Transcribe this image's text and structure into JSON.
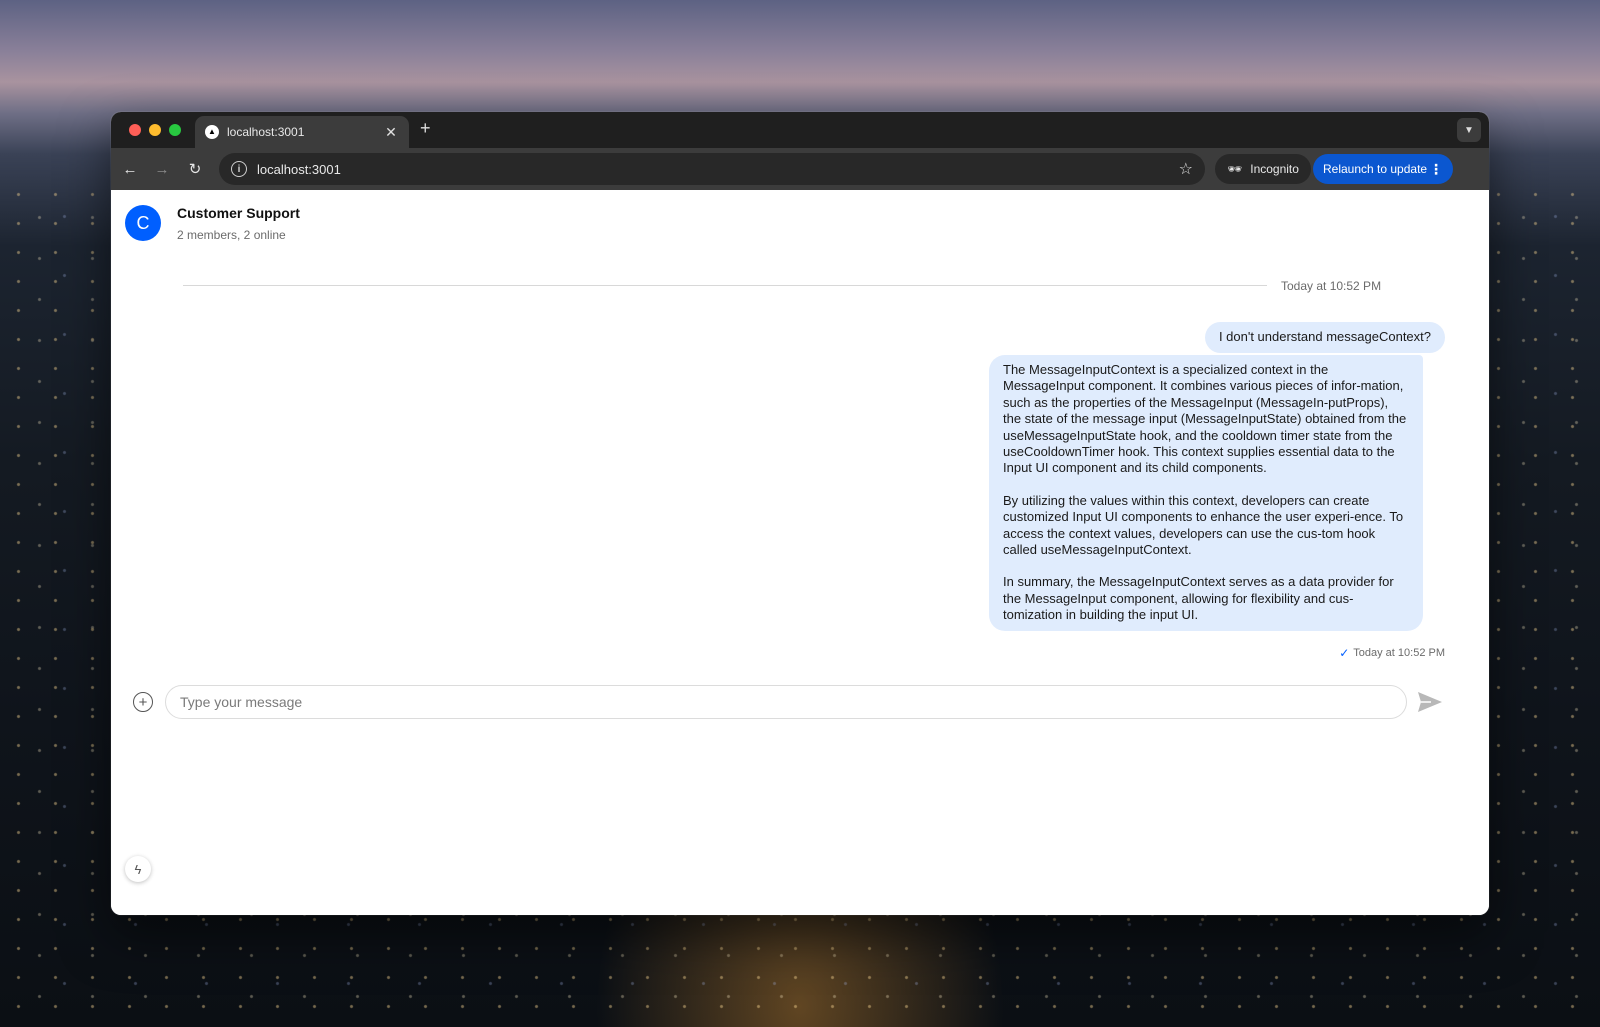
{
  "browser": {
    "tab_title": "localhost:3001",
    "url": "localhost:3001",
    "incognito_label": "Incognito",
    "relaunch_label": "Relaunch to update"
  },
  "channel": {
    "avatar_letter": "C",
    "title": "Customer Support",
    "subtitle": "2 members, 2 online"
  },
  "messages": {
    "date_separator": "Today at 10:52 PM",
    "user_message": "I don't understand messageContext?",
    "reply_paragraphs": [
      "The MessageInputContext is a specialized context in the MessageInput component. It combines various pieces of infor-mation, such as the properties of the MessageInput (MessageIn-putProps), the state of the message input (MessageInputState) obtained from the useMessageInputState hook, and the cooldown timer state from the useCooldownTimer hook. This context supplies essential data to the Input UI component and its child components.",
      "By utilizing the values within this context, developers can create customized Input UI components to enhance the user experi-ence. To access the context values, developers can use the cus-tom hook called useMessageInputContext.",
      "In summary, the MessageInputContext serves as a data provider for the MessageInput component, allowing for flexibility and cus-tomization in building the input UI."
    ],
    "reply_timestamp": "Today at 10:52 PM"
  },
  "composer": {
    "placeholder": "Type your message"
  },
  "icons": {
    "attach": "plus-circle-icon",
    "send": "send-icon",
    "bolt": "lightning-icon"
  },
  "colors": {
    "accent": "#005fff",
    "bubble": "#e0ecfd",
    "relaunch": "#0b57d0"
  }
}
